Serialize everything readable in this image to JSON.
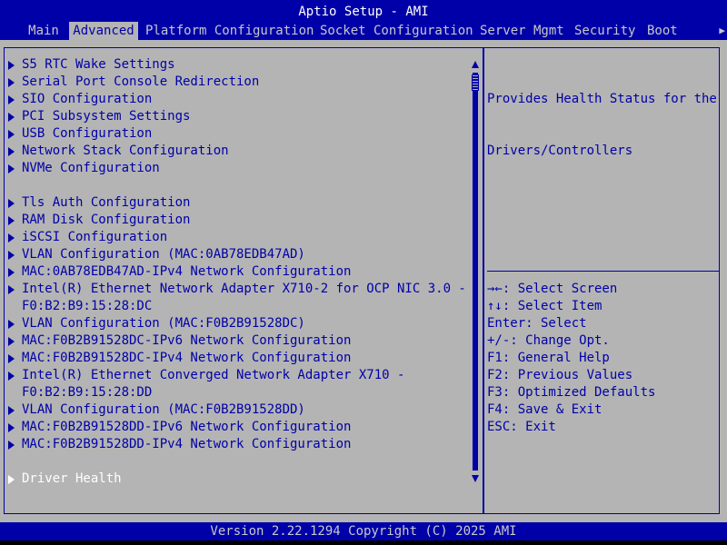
{
  "title": "Aptio Setup - AMI",
  "tabs": [
    {
      "label": "Main"
    },
    {
      "label": "Advanced"
    },
    {
      "label": "Platform Configuration"
    },
    {
      "label": "Socket Configuration"
    },
    {
      "label": "Server Mgmt"
    },
    {
      "label": "Security"
    },
    {
      "label": "Boot"
    }
  ],
  "active_tab": "Advanced",
  "menu": {
    "items": [
      {
        "label": "S5 RTC Wake Settings"
      },
      {
        "label": "Serial Port Console Redirection"
      },
      {
        "label": "SIO Configuration"
      },
      {
        "label": "PCI Subsystem Settings"
      },
      {
        "label": "USB Configuration"
      },
      {
        "label": "Network Stack Configuration"
      },
      {
        "label": "NVMe Configuration"
      },
      {
        "label": "Tls Auth Configuration"
      },
      {
        "label": "RAM Disk Configuration"
      },
      {
        "label": "iSCSI Configuration"
      },
      {
        "label": "VLAN Configuration (MAC:0AB78EDB47AD)"
      },
      {
        "label": "MAC:0AB78EDB47AD-IPv4 Network Configuration"
      },
      {
        "label": "Intel(R) Ethernet Network Adapter X710-2 for OCP NIC 3.0 -",
        "continuation": "F0:B2:B9:15:28:DC"
      },
      {
        "label": "VLAN Configuration (MAC:F0B2B91528DC)"
      },
      {
        "label": "MAC:F0B2B91528DC-IPv6 Network Configuration"
      },
      {
        "label": "MAC:F0B2B91528DC-IPv4 Network Configuration"
      },
      {
        "label": "Intel(R) Ethernet Converged Network Adapter X710 -",
        "continuation": "F0:B2:B9:15:28:DD"
      },
      {
        "label": "VLAN Configuration (MAC:F0B2B91528DD)"
      },
      {
        "label": "MAC:F0B2B91528DD-IPv6 Network Configuration"
      },
      {
        "label": "MAC:F0B2B91528DD-IPv4 Network Configuration"
      },
      {
        "label": "Driver Health"
      }
    ],
    "selected": "Driver Health"
  },
  "help": {
    "line1": "Provides Health Status for the",
    "line2": "Drivers/Controllers"
  },
  "keys": [
    {
      "text": "→←: Select Screen"
    },
    {
      "text": "↑↓: Select Item"
    },
    {
      "text": "Enter: Select"
    },
    {
      "text": "+/-: Change Opt."
    },
    {
      "text": "F1: General Help"
    },
    {
      "text": "F2: Previous Values"
    },
    {
      "text": "F3: Optimized Defaults"
    },
    {
      "text": "F4: Save & Exit"
    },
    {
      "text": "ESC: Exit"
    }
  ],
  "footer": "Version 2.22.1294 Copyright (C) 2025 AMI",
  "colors": {
    "background": "#b4b4b4",
    "bar": "#0000a8",
    "text": "#0000a8",
    "highlight_text": "#ffffff"
  }
}
